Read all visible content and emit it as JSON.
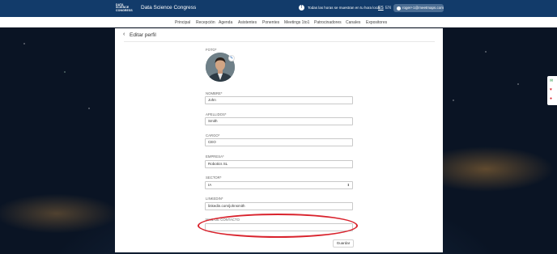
{
  "header": {
    "logo_lines": [
      "DATA",
      "SCIENCE",
      "CONGRESS"
    ],
    "brand": "Data Science Congress",
    "timezone_notice": "Todas las horas se muestran en tu hora local",
    "lang_es": "ES",
    "lang_en": "EN",
    "user_email": "roger+1@meetmaps.com"
  },
  "nav": [
    "Principal",
    "Recepción",
    "Agenda",
    "Asistentes",
    "Ponentes",
    "Meetings 1to1",
    "Patrocinadores",
    "Canales",
    "Expositores"
  ],
  "page": {
    "title": "Editar perfil",
    "back_icon": "‹"
  },
  "form": {
    "foto_label": "FOTO*",
    "nombre_label": "NOMBRE*",
    "nombre_value": "John",
    "apellidos_label": "APELLIDOS*",
    "apellidos_value": "Smith",
    "cargo_label": "CARGO*",
    "cargo_value": "CEO",
    "empresa_label": "EMPRESA*",
    "empresa_value": "Robotics SL",
    "sector_label": "SECTOR*",
    "sector_value": "IA",
    "linkedin_label": "LINKEDIN*",
    "linkedin_value": "linkedin.com/johnsmith",
    "mail_label": "MAIL DE CONTACTO",
    "mail_value": "",
    "save_label": "Guardar"
  },
  "colors": {
    "header_bg": "#123b6a",
    "highlight": "#d9232d"
  }
}
